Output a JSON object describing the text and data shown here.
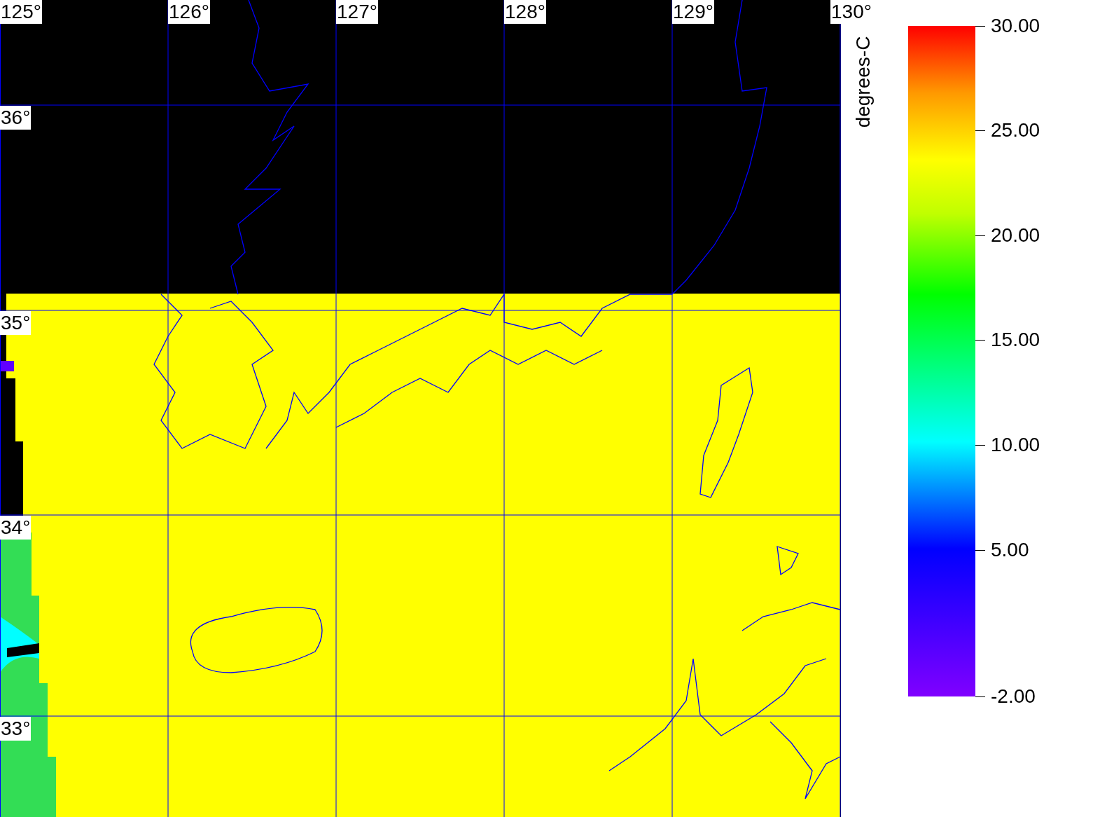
{
  "map": {
    "longitude_labels": [
      "125°",
      "126°",
      "127°",
      "128°",
      "129°",
      "130°"
    ],
    "latitude_labels": [
      "36°",
      "35°",
      "34°",
      "33°"
    ]
  },
  "colorbar": {
    "unit": "degrees-C",
    "ticks": [
      "30.00",
      "25.00",
      "20.00",
      "15.00",
      "10.00",
      "5.00",
      "-2.00"
    ]
  }
}
